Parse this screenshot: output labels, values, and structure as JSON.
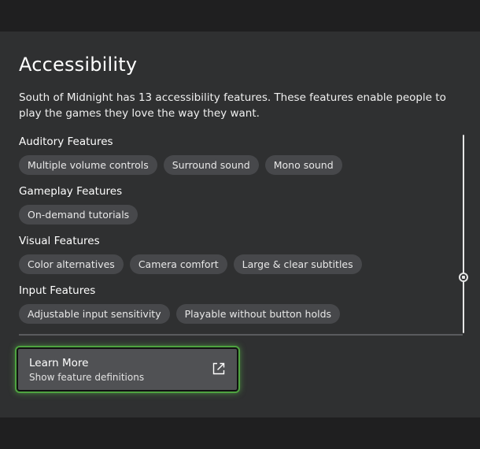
{
  "accessibility": {
    "title": "Accessibility",
    "description": "South of Midnight has 13 accessibility features. These features enable people to play the games they love the way they want.",
    "sections": [
      {
        "title": "Auditory Features",
        "features": [
          "Multiple volume controls",
          "Surround sound",
          "Mono sound"
        ]
      },
      {
        "title": "Gameplay Features",
        "features": [
          "On-demand tutorials"
        ]
      },
      {
        "title": "Visual Features",
        "features": [
          "Color alternatives",
          "Camera comfort",
          "Large & clear subtitles"
        ]
      },
      {
        "title": "Input Features",
        "features": [
          "Adjustable input sensitivity",
          "Playable without button holds"
        ]
      }
    ],
    "learn_more": {
      "title": "Learn More",
      "subtitle": "Show feature definitions",
      "icon": "external-link-icon"
    },
    "colors": {
      "panel": "#2f3031",
      "chip": "#47484b",
      "focus_ring": "#4ea340"
    }
  }
}
